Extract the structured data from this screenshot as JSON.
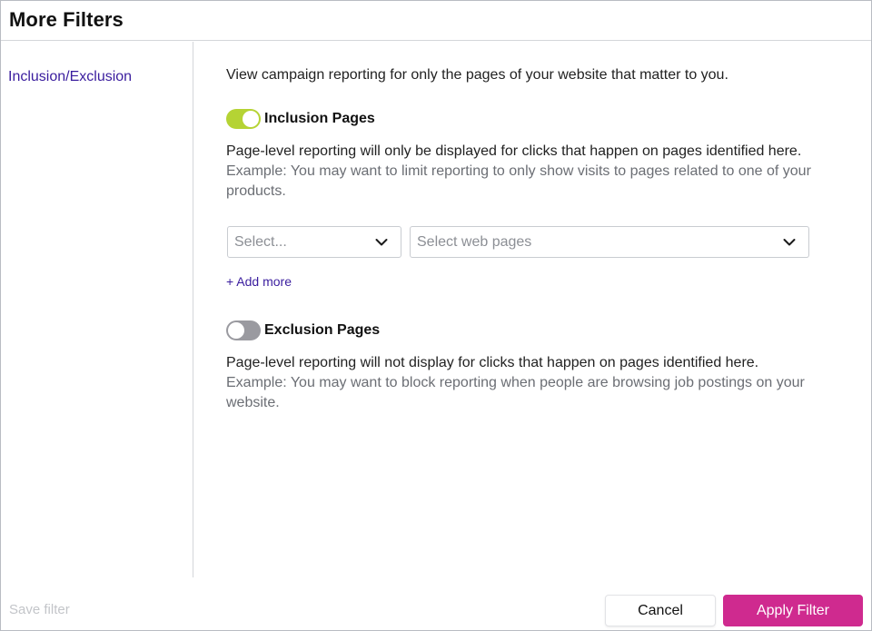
{
  "dialog": {
    "title": "More Filters"
  },
  "sidebar": {
    "items": [
      {
        "label": "Inclusion/Exclusion"
      }
    ]
  },
  "main": {
    "intro": "View campaign reporting for only the pages of your website that matter to you.",
    "inclusion": {
      "label": "Inclusion Pages",
      "enabled": true,
      "description": "Page-level reporting will only be displayed for clicks that happen on pages identified here.",
      "example": "Example: You may want to limit reporting to only show visits to pages related to one of your products.",
      "select_type_placeholder": "Select...",
      "select_pages_placeholder": "Select web pages",
      "add_more": "+ Add more"
    },
    "exclusion": {
      "label": "Exclusion Pages",
      "enabled": false,
      "description": "Page-level reporting will not display for clicks that happen on pages identified here.",
      "example": "Example: You may want to block reporting when people are browsing job postings on your website."
    }
  },
  "footer": {
    "save_filter": "Save filter",
    "cancel": "Cancel",
    "apply": "Apply Filter"
  },
  "colors": {
    "accent": "#cf2a8f",
    "toggle_on": "#b5d334",
    "toggle_off": "#9a9aa0",
    "link": "#3a1d9e"
  },
  "icons": {
    "dropdown": "chevron-down-icon"
  }
}
